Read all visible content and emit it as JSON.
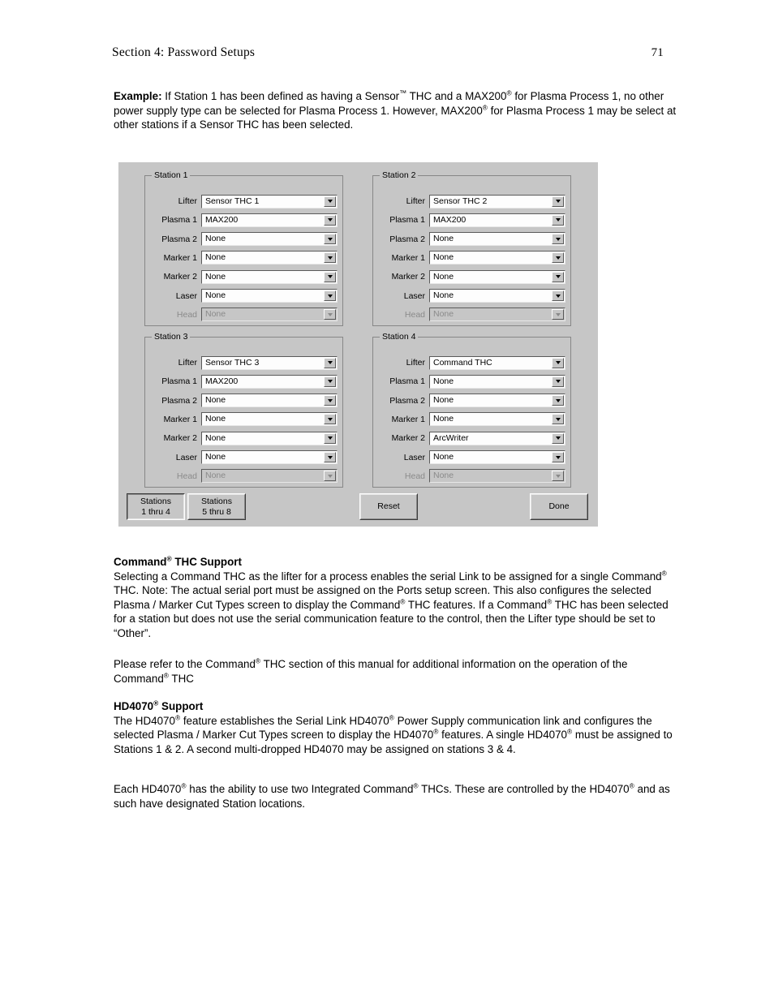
{
  "header": {
    "section_title": "Section 4: Password Setups",
    "page_number": "71"
  },
  "example": {
    "label": "Example:",
    "line1_a": " If Station 1 has been defined as having a Sensor",
    "tm": "™",
    "line1_b": " THC and a MAX200",
    "reg": "®",
    "line1_c": " for Plasma",
    "line2_a": "Process 1, no other power supply type can be selected for Plasma Process 1.  However, MAX200",
    "line3": "for Plasma Process 1 may be select at other stations if a Sensor THC has been selected."
  },
  "dialog": {
    "stations": [
      {
        "title": "Station 1",
        "fields": [
          {
            "label": "Lifter",
            "value": "Sensor THC 1",
            "disabled": false
          },
          {
            "label": "Plasma 1",
            "value": "MAX200",
            "disabled": false
          },
          {
            "label": "Plasma 2",
            "value": "None",
            "disabled": false
          },
          {
            "label": "Marker 1",
            "value": "None",
            "disabled": false
          },
          {
            "label": "Marker 2",
            "value": "None",
            "disabled": false
          },
          {
            "label": "Laser",
            "value": "None",
            "disabled": false
          },
          {
            "label": "Head",
            "value": "None",
            "disabled": true
          }
        ]
      },
      {
        "title": "Station 2",
        "fields": [
          {
            "label": "Lifter",
            "value": "Sensor THC 2",
            "disabled": false
          },
          {
            "label": "Plasma 1",
            "value": "MAX200",
            "disabled": false
          },
          {
            "label": "Plasma 2",
            "value": "None",
            "disabled": false
          },
          {
            "label": "Marker 1",
            "value": "None",
            "disabled": false
          },
          {
            "label": "Marker 2",
            "value": "None",
            "disabled": false
          },
          {
            "label": "Laser",
            "value": "None",
            "disabled": false
          },
          {
            "label": "Head",
            "value": "None",
            "disabled": true
          }
        ]
      },
      {
        "title": "Station 3",
        "fields": [
          {
            "label": "Lifter",
            "value": "Sensor THC 3",
            "disabled": false
          },
          {
            "label": "Plasma 1",
            "value": "MAX200",
            "disabled": false
          },
          {
            "label": "Plasma 2",
            "value": "None",
            "disabled": false
          },
          {
            "label": "Marker 1",
            "value": "None",
            "disabled": false
          },
          {
            "label": "Marker 2",
            "value": "None",
            "disabled": false
          },
          {
            "label": "Laser",
            "value": "None",
            "disabled": false
          },
          {
            "label": "Head",
            "value": "None",
            "disabled": true
          }
        ]
      },
      {
        "title": "Station 4",
        "fields": [
          {
            "label": "Lifter",
            "value": "Command THC",
            "disabled": false
          },
          {
            "label": "Plasma 1",
            "value": "None",
            "disabled": false
          },
          {
            "label": "Plasma 2",
            "value": "None",
            "disabled": false
          },
          {
            "label": "Marker 1",
            "value": "None",
            "disabled": false
          },
          {
            "label": "Marker 2",
            "value": "ArcWriter",
            "disabled": false
          },
          {
            "label": "Laser",
            "value": "None",
            "disabled": false
          },
          {
            "label": "Head",
            "value": "None",
            "disabled": true
          }
        ]
      }
    ],
    "buttons": {
      "stations_1_4_line1": "Stations",
      "stations_1_4_line2": "1 thru 4",
      "stations_5_8_line1": "Stations",
      "stations_5_8_line2": "5 thru 8",
      "reset": "Reset",
      "done": "Done"
    }
  },
  "command_section": {
    "heading_a": "Command",
    "heading_b": " THC Support",
    "p1_l1": "Selecting a Command THC as the lifter for a process enables the serial Link to be assigned for a",
    "p1_l2_a": "single Command",
    "p1_l2_b": " THC.  Note: The actual serial port must be assigned on the Ports setup screen.",
    "p1_l3_a": "This also configures the selected Plasma / Marker Cut Types screen to display the Command",
    "p1_l3_b": " THC",
    "p1_l4_a": "features.  If a Command",
    "p1_l4_b": " THC has been selected  for a station but does not use the serial",
    "p1_l5": "communication feature to the control, then the Lifter type should be set to “Other”."
  },
  "refer_section": {
    "l1_a": "Please refer to the Command",
    "l1_b": " THC section of this manual for additional information on the operation",
    "l2_a": "of the Command",
    "l2_b": " THC"
  },
  "hd_section": {
    "heading_a": "HD4070",
    "heading_b": " Support",
    "l1_a": "The HD4070",
    "l1_b": " feature establishes the Serial Link HD4070",
    "l1_c": " Power Supply communication link  and",
    "l2_a": "configures the selected Plasma / Marker Cut Types screen to display the HD4070",
    "l2_b": " features.  A single",
    "l3_a": "HD4070",
    "l3_b": " must be assigned to Stations 1 & 2.  A second multi-dropped HD4070 may be assigned on",
    "l4": "stations 3 & 4."
  },
  "each_section": {
    "l1_a": "Each HD4070",
    "l1_b": " has the ability to use two Integrated Command",
    "l1_c": " THCs.  These are controlled by the",
    "l2_a": "HD4070",
    "l2_b": " and as such have designated Station locations."
  },
  "symbols": {
    "reg": "®",
    "tm": "™"
  }
}
